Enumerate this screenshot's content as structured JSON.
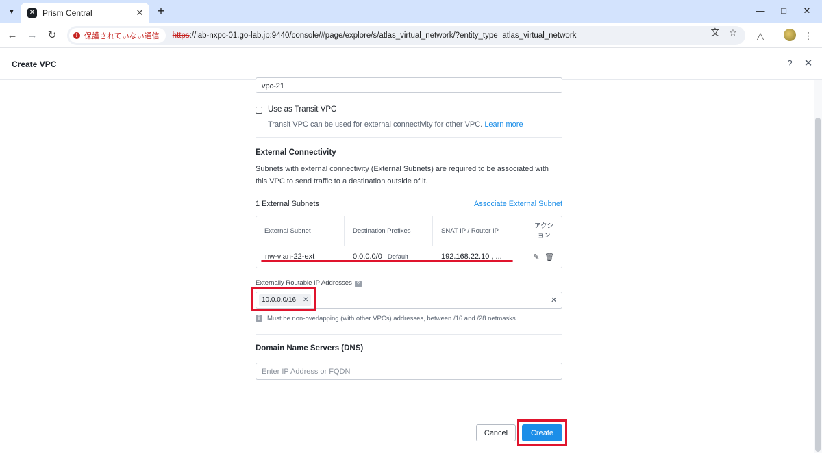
{
  "browser": {
    "tab_title": "Prism Central",
    "security_label": "保護されていない通信",
    "url_scheme": "https",
    "url_rest": "://lab-nxpc-01.go-lab.jp:9440/console/#page/explore/s/atlas_virtual_network/?entity_type=atlas_virtual_network"
  },
  "app": {
    "title": "Create VPC",
    "help": "?"
  },
  "form": {
    "name_value": "vpc-21",
    "transit_label": "Use as Transit VPC",
    "transit_help": "Transit VPC can be used for external connectivity for other VPC.",
    "learn_more": "Learn more",
    "ext_title": "External Connectivity",
    "ext_desc": "Subnets with external connectivity (External Subnets) are required to be associated with this VPC to send traffic to a destination outside of it.",
    "ext_count": "1 External Subnets",
    "assoc_link": "Associate External Subnet",
    "table": {
      "headers": [
        "External Subnet",
        "Destination Prefixes",
        "SNAT IP / Router IP",
        "アクション"
      ],
      "rows": [
        {
          "subnet": "nw-vlan-22-ext",
          "prefix": "0.0.0.0/0",
          "prefix_badge": "Default",
          "snat": "192.168.22.10 , ..."
        }
      ]
    },
    "routable_label": "Externally Routable IP Addresses",
    "routable_tags": [
      "10.0.0.0/16"
    ],
    "routable_hint": "Must be non-overlapping (with other VPCs) addresses, between /16 and /28 netmasks",
    "dns_title": "Domain Name Servers (DNS)",
    "dns_placeholder": "Enter IP Address or FQDN"
  },
  "footer": {
    "cancel": "Cancel",
    "create": "Create"
  },
  "colors": {
    "accent": "#1b8ee8",
    "annotation_red": "#e0142d",
    "insecure_red": "#c5221f"
  }
}
